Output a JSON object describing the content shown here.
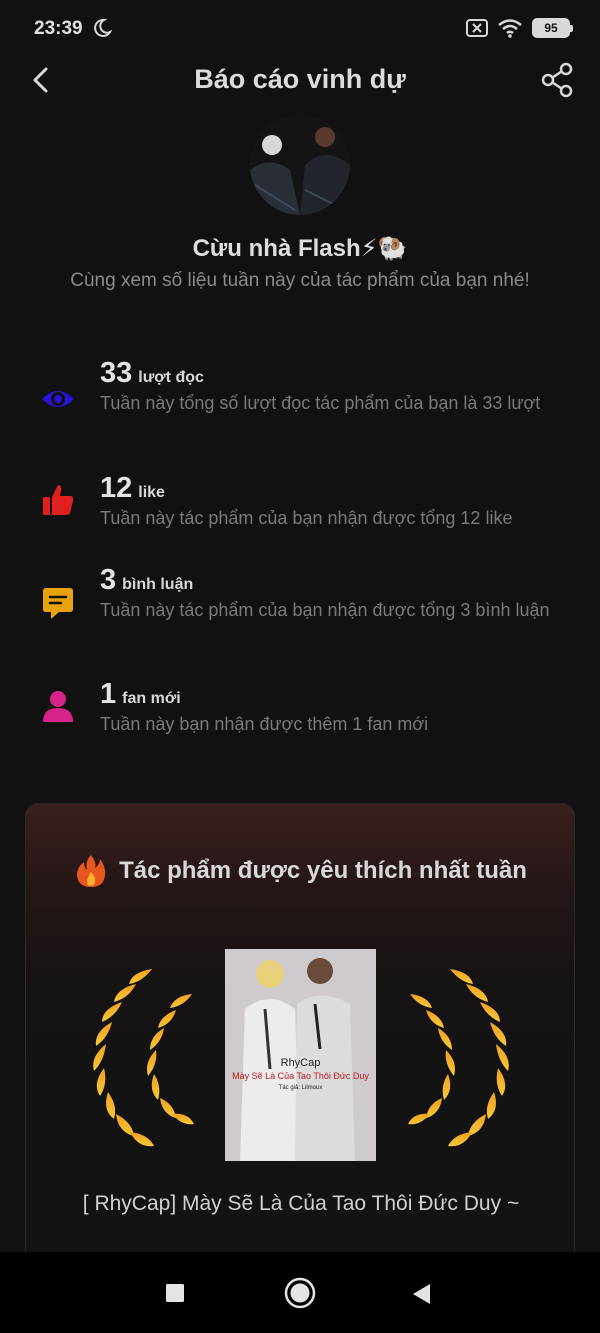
{
  "status_bar": {
    "time": "23:39",
    "battery": "95"
  },
  "header": {
    "title": "Báo cáo vinh dự"
  },
  "profile": {
    "name": "Cừu nhà Flash⚡🐏",
    "subtitle": "Cùng xem số liệu tuần này của tác phẩm của bạn nhé!"
  },
  "stats": [
    {
      "value": "33",
      "unit": "lượt đọc",
      "desc": "Tuần này tổng số lượt đọc tác phẩm của bạn là 33 lượt",
      "icon": "eye-icon",
      "color": "#2a12d6"
    },
    {
      "value": "12",
      "unit": "like",
      "desc": "Tuần này tác phẩm của bạn nhận được tổng 12 like",
      "icon": "thumbs-up-icon",
      "color": "#e01f1f"
    },
    {
      "value": "3",
      "unit": "bình luận",
      "desc": "Tuần này tác phẩm của bạn nhận được tổng 3 bình luận",
      "icon": "comment-icon",
      "color": "#e8a20c"
    },
    {
      "value": "1",
      "unit": "fan mới",
      "desc": "Tuần này bạn nhận được thêm 1 fan mới",
      "icon": "user-icon",
      "color": "#d6248a"
    }
  ],
  "favorite": {
    "title": "Tác phẩm được yêu thích nhất tuần",
    "book_title": "[ RhyCap] Mày Sẽ Là Của Tao Thôi Đức Duy ~",
    "cover": {
      "line1": "RhyCap",
      "line2": "Mày Sẽ Là Của Tao Thôi Đức Duy",
      "line3": "Tác giả: Lilmoux"
    }
  }
}
